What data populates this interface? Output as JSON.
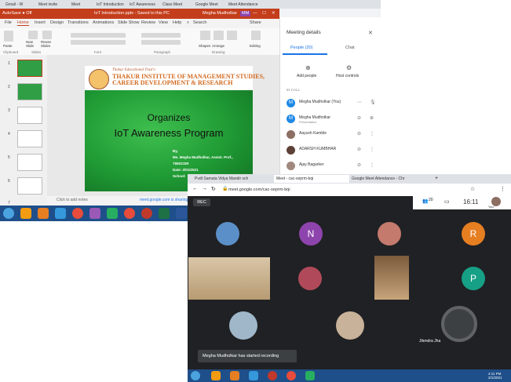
{
  "shot1": {
    "browser_tabs": [
      "Gmail - W",
      "Meet invite",
      "Meet",
      "IoT Introduction",
      "IoT Awareness",
      "Class Meet",
      "Google Meet",
      "Meet Attendance"
    ],
    "ppt": {
      "autosave": "AutoSave  ● Off",
      "title": "IoT Introduction.pptx - Saved to this PC",
      "user": "Megha Mudholkar",
      "user_initials": "MM",
      "tabs": [
        "File",
        "Home",
        "Insert",
        "Design",
        "Transitions",
        "Animations",
        "Slide Show",
        "Review",
        "View",
        "Help",
        "Search"
      ],
      "share": "Share",
      "groups": [
        "Clipboard",
        "Slides",
        "Font",
        "Paragraph",
        "Drawing",
        "Editing"
      ],
      "ribbon_buttons": [
        "Paste",
        "New Slide",
        "Reuse Slides",
        "Shapes",
        "Arrange",
        "Quick Styles",
        "Editing"
      ],
      "slide": {
        "tagline": "Thakur Educational Trust's",
        "institute_line1": "THAKUR INSTITUTE OF MANAGEMENT STUDIES,",
        "institute_line2": "CAREER DEVELOPMENT & RESEARCH",
        "organizes": "Organizes",
        "event": "IoT Awareness Program",
        "by": "By,",
        "speaker": "Ms. Megha Mudholkar, Assist. Prof.,",
        "org": "TIMSCDR",
        "date": "Date: 2/01/2021",
        "school": "School:"
      },
      "thumb_numbers": [
        "1",
        "2",
        "3",
        "4",
        "5",
        "6",
        "7"
      ],
      "notes": "Click to add notes",
      "meet_share": "meet.google.com is sharing your screen"
    },
    "meeting": {
      "title": "Meeting details",
      "close": "✕",
      "tab_people": "People (20)",
      "tab_chat": "Chat",
      "add_people": "Add people",
      "host_controls": "Host controls",
      "in_call": "IN CALL",
      "participants": [
        {
          "initial": "M",
          "name": "Megha Mudholkar (You)",
          "sub": "",
          "color": "#1e88e5"
        },
        {
          "initial": "M",
          "name": "Megha Mudholkar",
          "sub": "Presentation",
          "color": "#1e88e5"
        },
        {
          "initial": "",
          "name": "Aayush Kamble",
          "sub": "",
          "color": "#8d6e63"
        },
        {
          "initial": "",
          "name": "ADARSH KUMBHAR",
          "sub": "",
          "color": "#5d4037"
        },
        {
          "initial": "",
          "name": "Ajay Bagarker",
          "sub": "",
          "color": "#a1887f"
        }
      ]
    }
  },
  "shot2": {
    "browser_tabs": [
      "Pvdt Samata Vidya Mandir sch",
      "Meet - cac-xeprm-bqi",
      "Google Meet Attendance - Chr"
    ],
    "url": "meet.google.com/cac-xeprm-bqi",
    "rec_label": "REC",
    "people_count": "20",
    "time": "16:11",
    "you_label": "You",
    "tiles": [
      {
        "initial": "N",
        "color": "#8e44ad"
      },
      {
        "initial": "R",
        "color": "#e67e22"
      },
      {
        "initial": "P",
        "color": "#16a085"
      }
    ],
    "speaker_name": "Jitendra Jha",
    "toast": "Megha Mudholkar has started recording",
    "clock": "4:11 PM",
    "clock_date": "2/1/2021"
  }
}
